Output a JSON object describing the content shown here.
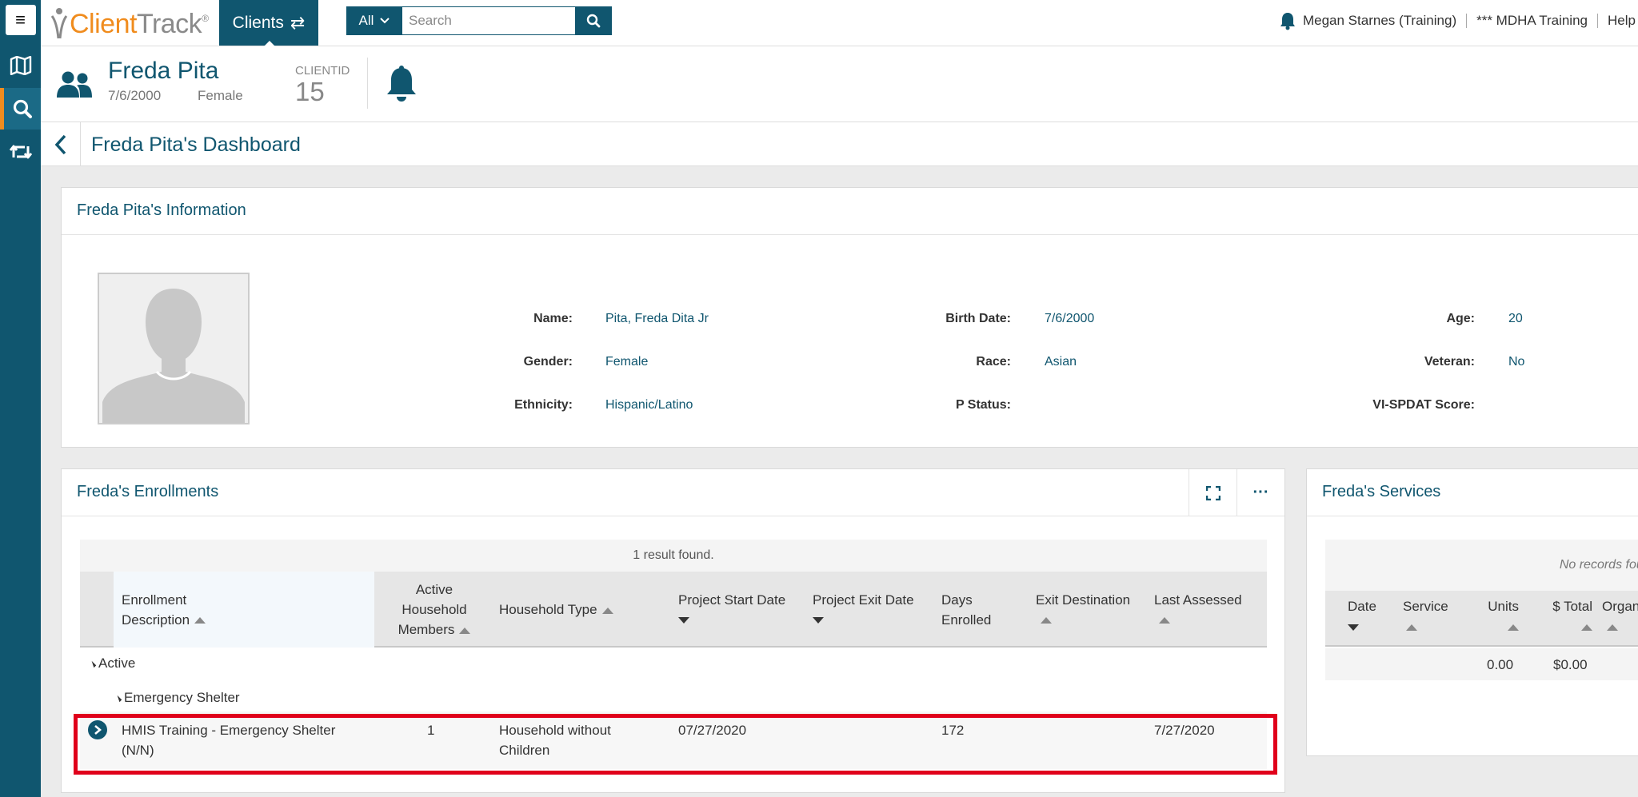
{
  "app": {
    "logo_client": "Client",
    "logo_track": "Track",
    "logo_mark": "®",
    "clients_tab": "Clients"
  },
  "search": {
    "scope": "All",
    "placeholder": "Search"
  },
  "user": {
    "name": "Megan Starnes (Training)",
    "org": "*** MDHA Training",
    "help": "Help"
  },
  "client": {
    "name": "Freda Pita",
    "dob": "7/6/2000",
    "gender": "Female",
    "id_label": "CLIENTID",
    "id_value": "15"
  },
  "dashboard": {
    "title": "Freda Pita's Dashboard"
  },
  "info": {
    "title": "Freda Pita's Information",
    "fields": {
      "name_label": "Name:",
      "name_value": "Pita, Freda Dita Jr",
      "gender_label": "Gender:",
      "gender_value": "Female",
      "ethnicity_label": "Ethnicity:",
      "ethnicity_value": "Hispanic/Latino",
      "birth_label": "Birth Date:",
      "birth_value": "7/6/2000",
      "race_label": "Race:",
      "race_value": "Asian",
      "pstatus_label": "P Status:",
      "pstatus_value": "",
      "age_label": "Age:",
      "age_value": "20",
      "veteran_label": "Veteran:",
      "veteran_value": "No",
      "vispdat_label": "VI-SPDAT Score:",
      "vispdat_value": ""
    }
  },
  "enrollments": {
    "title": "Freda's Enrollments",
    "result_text": "1 result found.",
    "columns": {
      "description_1": "Enrollment",
      "description_2": "Description",
      "members_1": "Active",
      "members_2": "Household",
      "members_3": "Members",
      "household_type": "Household Type",
      "start_date": "Project Start Date",
      "exit_date": "Project Exit Date",
      "days_1": "Days",
      "days_2": "Enrolled",
      "exit_dest": "Exit Destination",
      "last_assessed": "Last Assessed"
    },
    "group_status": "Active",
    "group_type": "Emergency Shelter",
    "row": {
      "description_1": "HMIS Training - Emergency Shelter",
      "description_2": "(N/N)",
      "members": "1",
      "household_type_1": "Household without",
      "household_type_2": "Children",
      "start_date": "07/27/2020",
      "exit_date": "",
      "days": "172",
      "exit_dest": "",
      "last_assessed": "7/27/2020"
    }
  },
  "services": {
    "title": "Freda's Services",
    "empty_text": "No records found.",
    "columns": {
      "date": "Date",
      "service": "Service",
      "units": "Units",
      "total": "$ Total",
      "org": "Organization"
    },
    "totals": {
      "units": "0.00",
      "total": "$0.00"
    }
  },
  "colors": {
    "brand": "#10566f",
    "accent": "#f08c1e",
    "highlight": "#e0001b"
  }
}
